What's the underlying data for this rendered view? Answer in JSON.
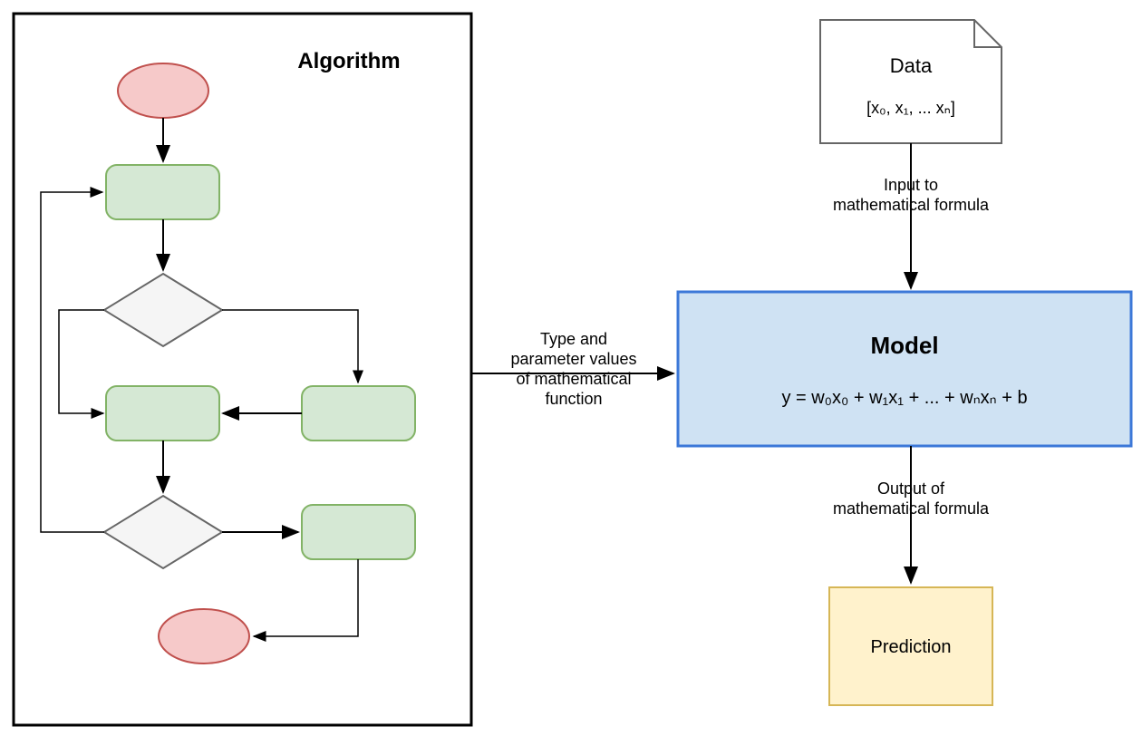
{
  "algorithm": {
    "title": "Algorithm"
  },
  "connector1": {
    "line1": "Type and",
    "line2": "parameter values",
    "line3": "of mathematical",
    "line4": "function"
  },
  "data_box": {
    "title": "Data",
    "content": "[x₀, x₁, ... xₙ]"
  },
  "connector2": {
    "line1": "Input to",
    "line2": "mathematical formula"
  },
  "model_box": {
    "title": "Model",
    "formula": "y = w₀x₀ + w₁x₁ + ... + wₙxₙ + b"
  },
  "connector3": {
    "line1": "Output of",
    "line2": "mathematical formula"
  },
  "prediction_box": {
    "label": "Prediction"
  },
  "colors": {
    "red_fill": "#f6c9c9",
    "red_stroke": "#c0504d",
    "green_fill": "#d5e8d4",
    "green_stroke": "#82b366",
    "grey_fill": "#f5f5f5",
    "grey_stroke": "#666666",
    "blue_fill": "#cfe2f3",
    "blue_stroke": "#3c78d8",
    "yellow_fill": "#fff2cc",
    "yellow_stroke": "#d6b656"
  }
}
